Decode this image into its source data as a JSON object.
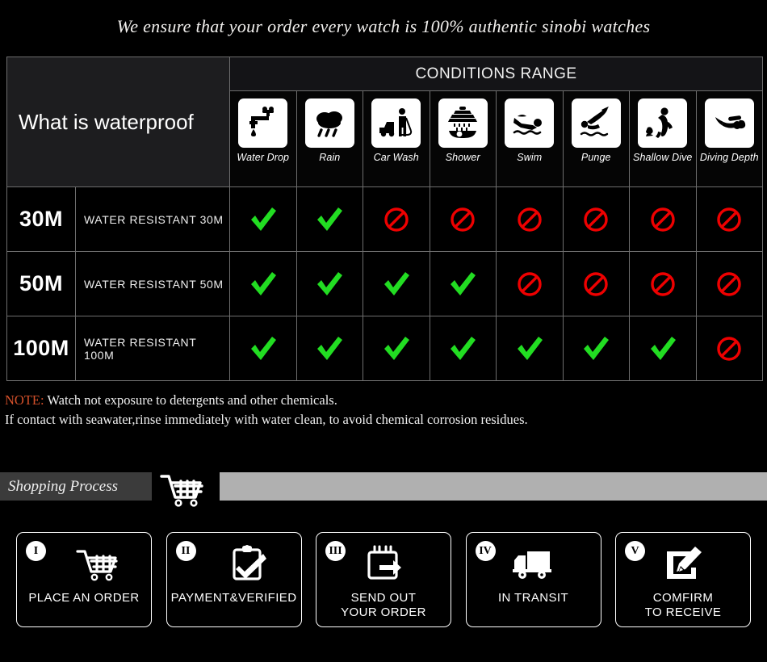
{
  "headline": "We ensure that your order every watch is 100% authentic sinobi watches",
  "table": {
    "title": "What is waterproof",
    "conditions_header": "CONDITIONS RANGE",
    "columns": [
      {
        "label": "Water Drop",
        "icon": "faucet-drop-icon"
      },
      {
        "label": "Rain",
        "icon": "rain-cloud-icon"
      },
      {
        "label": "Car Wash",
        "icon": "car-wash-icon"
      },
      {
        "label": "Shower",
        "icon": "shower-icon"
      },
      {
        "label": "Swim",
        "icon": "swimmer-icon"
      },
      {
        "label": "Punge",
        "icon": "plunge-dive-icon"
      },
      {
        "label": "Shallow Dive",
        "icon": "shallow-dive-icon"
      },
      {
        "label": "Diving Depth",
        "icon": "scuba-diver-icon"
      }
    ],
    "rows": [
      {
        "depth": "30M",
        "description": "WATER RESISTANT  30M",
        "marks": [
          "yes",
          "yes",
          "no",
          "no",
          "no",
          "no",
          "no",
          "no"
        ]
      },
      {
        "depth": "50M",
        "description": "WATER RESISTANT 50M",
        "marks": [
          "yes",
          "yes",
          "yes",
          "yes",
          "no",
          "no",
          "no",
          "no"
        ]
      },
      {
        "depth": "100M",
        "description": "WATER RESISTANT  100M",
        "marks": [
          "yes",
          "yes",
          "yes",
          "yes",
          "yes",
          "yes",
          "yes",
          "no"
        ]
      }
    ],
    "mark_icons": {
      "yes": "green-check-icon",
      "no": "red-prohibition-icon"
    },
    "colors": {
      "check": "#22dd22",
      "prohibition": "#ee0000",
      "border": "#6e6e6e"
    }
  },
  "note": {
    "label": "NOTE:",
    "line1": " Watch not exposure to detergents and other chemicals.",
    "line2": "If contact with seawater,rinse immediately with water clean, to avoid chemical corrosion residues.",
    "label_color": "#d4502a"
  },
  "shopping_process": {
    "title": "Shopping Process",
    "cart_icon": "shopping-cart-icon",
    "bar_color": "#b0b0b0",
    "label_bg": "#3b3b3b"
  },
  "steps": [
    {
      "numeral": "I",
      "label": "PLACE AN ORDER",
      "icon": "shopping-cart-icon"
    },
    {
      "numeral": "II",
      "label": "PAYMENT&VERIFIED",
      "icon": "clipboard-check-icon"
    },
    {
      "numeral": "III",
      "label": "SEND OUT\nYOUR ORDER",
      "icon": "calendar-arrow-icon"
    },
    {
      "numeral": "IV",
      "label": "IN TRANSIT",
      "icon": "delivery-truck-icon"
    },
    {
      "numeral": "V",
      "label": "COMFIRM\nTO RECEIVE",
      "icon": "note-pencil-icon"
    }
  ]
}
